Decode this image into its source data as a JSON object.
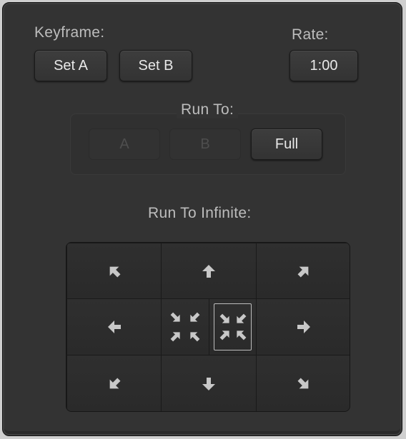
{
  "keyframe": {
    "label": "Keyframe:",
    "set_a": "Set A",
    "set_b": "Set B"
  },
  "rate": {
    "label": "Rate:",
    "value": "1:00"
  },
  "run_to": {
    "label": "Run To:",
    "a": "A",
    "b": "B",
    "full": "Full"
  },
  "run_to_infinite": {
    "label": "Run To Infinite:",
    "cells": [
      {
        "icon": "arrow-up-left-icon"
      },
      {
        "icon": "arrow-up-icon"
      },
      {
        "icon": "arrow-up-right-icon"
      },
      {
        "icon": "arrow-left-icon"
      },
      {
        "icon": "shrink-icon"
      },
      {
        "icon": "expand-icon",
        "selected": true
      },
      {
        "icon": "arrow-right-icon"
      },
      {
        "icon": "arrow-down-left-icon"
      },
      {
        "icon": "arrow-down-icon"
      },
      {
        "icon": "arrow-down-right-icon"
      }
    ]
  },
  "colors": {
    "panel": "#333333",
    "text": "#bdbdbd",
    "button_text": "#e9e9e9",
    "icon": "#c8c8c8"
  }
}
